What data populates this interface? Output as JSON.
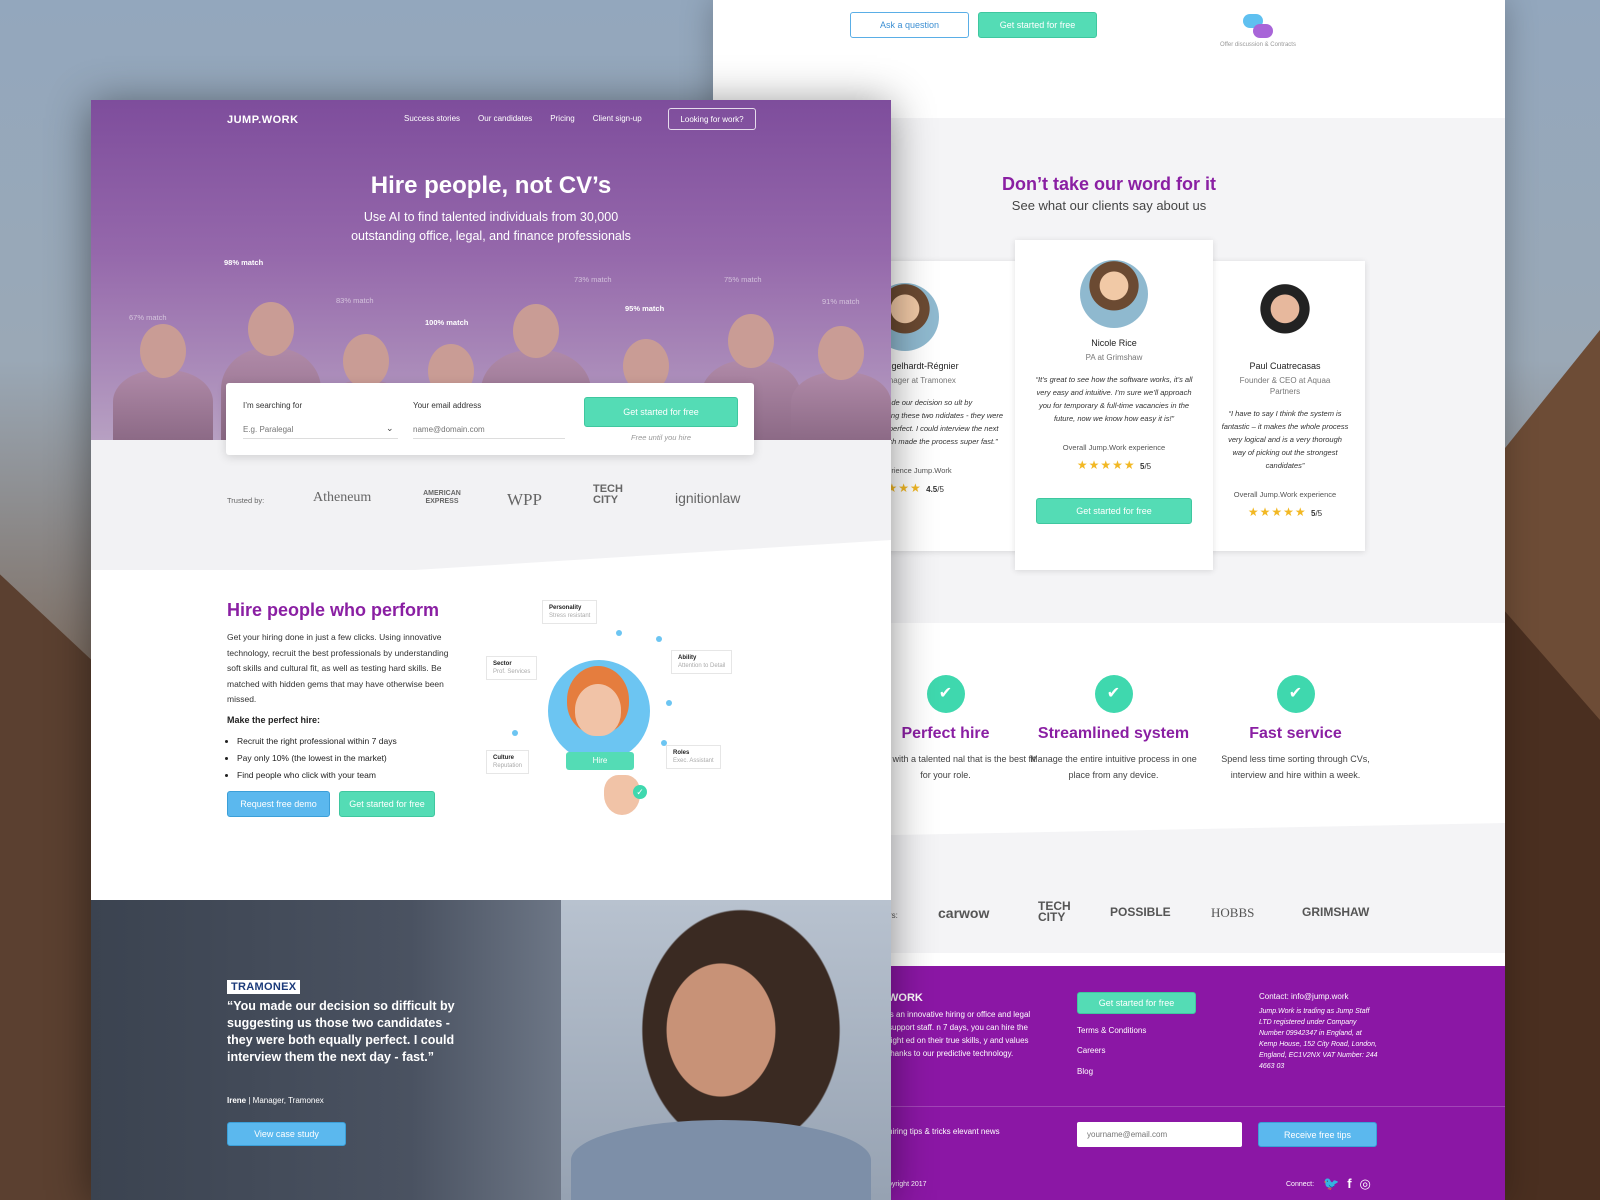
{
  "colors": {
    "brand_purple": "#8a1fa3",
    "hero_purple": "#8e5ea9",
    "green": "#54dcb5",
    "blue": "#5bb8ee"
  },
  "back": {
    "top": {
      "ask_label": "Ask a question",
      "start_label": "Get started for free",
      "offer_label": "Offer discussion & Contracts"
    },
    "testimonials": {
      "title": "Don’t take our word for it",
      "subtitle": "See what our clients say about us",
      "cards": [
        {
          "name": "ene Engelhardt-Régnier",
          "role": "ess Manager at Tramonex",
          "quote": "guys made our decision so ult by suggesting these two ndidates - they were both lly perfect. I could interview the next day which made the process super fast.”",
          "overall": "rall experience Jump.Work",
          "rating": "4.5",
          "out_of": "/5"
        },
        {
          "name": "Nicole Rice",
          "role": "PA at Grimshaw",
          "quote": "“It’s great to see how the software works, it’s all very easy and intuitive. I’m sure we’ll approach you for temporary & full-time vacancies in the future, now we know how easy it is!”",
          "overall": "Overall Jump.Work experience",
          "rating": "5",
          "out_of": "/5",
          "button": "Get started for free"
        },
        {
          "name": "Paul Cuatrecasas",
          "role": "Founder & CEO at Aquaa Partners",
          "quote": "“I have to say I think the system is fantastic – it makes the whole process very logical and is a very thorough way of picking out the strongest candidates”",
          "overall": "Overall Jump.Work experience",
          "rating": "5",
          "out_of": "/5"
        }
      ]
    },
    "features": [
      {
        "title": "Perfect hire",
        "text": "matched with a talented nal that is the best fit for your role."
      },
      {
        "title": "Streamlined system",
        "text": "Manage the entire intuitive process in one place from any device."
      },
      {
        "title": "Fast service",
        "text": "Spend less time sorting through CVs, interview and hire within a week."
      }
    ],
    "logos": {
      "prefix": "rs:",
      "items": [
        "carwow",
        "TECH CITY",
        "POSSIBLE",
        "HOBBS",
        "GRIMSHAW"
      ]
    },
    "footer": {
      "brand": "WORK",
      "desc": "is an innovative hiring or office and legal support staff. n 7 days, you can hire the right ed on their true skills, y and values thanks to our predictive technology.",
      "start_label": "Get started for free",
      "links": [
        "Terms & Conditions",
        "Careers",
        "Blog"
      ],
      "contact": "Contact: info@jump.work",
      "legal": "Jump.Work is trading as Jump Staff LTD registered under Company Number 09942347 in England, at Kemp House, 152 City Road, London, England, EC1V2NX VAT Number: 244 4663 03",
      "tips": "hiring tips & tricks elevant news",
      "email_placeholder": "yourname@email.com",
      "tips_button": "Receive free tips",
      "copyright": "pyright 2017",
      "connect": "Connect:"
    }
  },
  "front": {
    "logo": "JUMP.WORK",
    "nav": [
      "Success stories",
      "Our candidates",
      "Pricing",
      "Client sign-up"
    ],
    "looking": "Looking for work?",
    "hero_title": "Hire people, not CV’s",
    "hero_sub": "Use AI to find talented individuals from 30,000 outstanding office, legal, and finance professionals",
    "matches": [
      "67% match",
      "98% match",
      "83% match",
      "100% match",
      "73% match",
      "95% match",
      "75% match",
      "91% match"
    ],
    "search": {
      "searching_label": "I’m searching for",
      "searching_placeholder": "E.g. Paralegal",
      "email_label": "Your email address",
      "email_placeholder": "name@domain.com",
      "button": "Get started for free",
      "note": "Free until you hire"
    },
    "trusted": {
      "label": "Trusted by:",
      "logos": [
        "Atheneum",
        "AMERICAN EXPRESS",
        "WPP",
        "TECH CITY",
        "ignitionlaw"
      ]
    },
    "perform": {
      "title": "Hire people who perform",
      "para": "Get your hiring done in just a few clicks. Using innovative technology, recruit the best professionals by understanding soft skills and cultural fit, as well as testing hard skills. Be matched with hidden gems that may have otherwise been missed.",
      "make": "Make the perfect hire:",
      "bullets": [
        "Recruit the right professional within 7 days",
        "Pay only 10% (the lowest in the market)",
        "Find people who click with your team"
      ],
      "demo_button": "Request free demo",
      "start_button": "Get started for free",
      "tags": [
        {
          "k": "Personality",
          "v": "Stress resistant"
        },
        {
          "k": "Sector",
          "v": "Prof. Services"
        },
        {
          "k": "Ability",
          "v": "Attention to Detail"
        },
        {
          "k": "Culture",
          "v": "Reputation"
        },
        {
          "k": "Roles",
          "v": "Exec. Assistant"
        }
      ],
      "hire": "Hire"
    },
    "case": {
      "logo": "TRAMONEX",
      "quote": "“You made our decision so difficult by suggesting us those two candidates - they were both equally perfect. I could interview them the next day - fast.”",
      "author": "Irene",
      "author_role": "Manager, Tramonex",
      "button": "View case study"
    }
  }
}
